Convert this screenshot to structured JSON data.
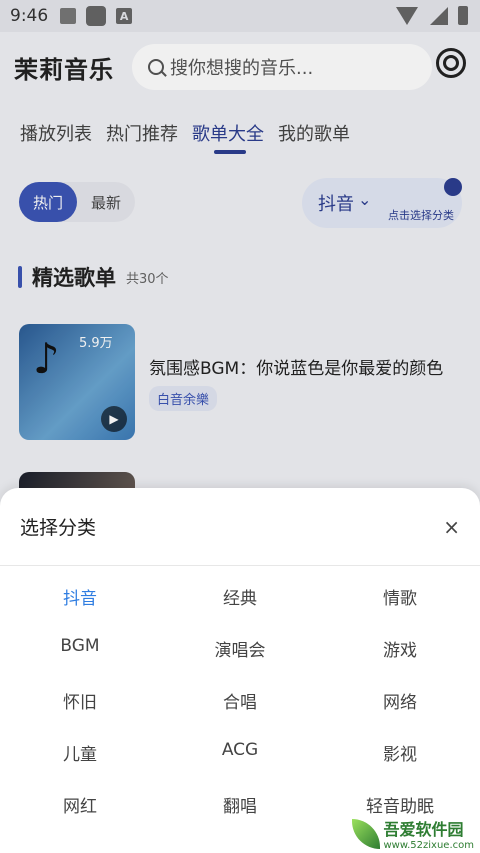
{
  "statusbar": {
    "time": "9:46",
    "badge": "A"
  },
  "header": {
    "title": "茉莉音乐",
    "search_placeholder": "搜你想搜的音乐..."
  },
  "tabs": [
    "播放列表",
    "热门推荐",
    "歌单大全",
    "我的歌单"
  ],
  "filters": [
    "热门",
    "最新"
  ],
  "category": {
    "label": "抖音",
    "hint": "点击选择分类"
  },
  "section": {
    "title": "精选歌单",
    "count": "共30个"
  },
  "playlists": [
    {
      "plays": "5.9万",
      "title": "氛围感BGM：你说蓝色是你最爱的颜色",
      "tag": "白音余樂"
    }
  ],
  "sheet": {
    "title": "选择分类",
    "close": "×",
    "items": [
      "抖音",
      "经典",
      "情歌",
      "BGM",
      "演唱会",
      "游戏",
      "怀旧",
      "合唱",
      "网络",
      "儿童",
      "ACG",
      "影视",
      "网红",
      "翻唱",
      "轻音助眠"
    ]
  },
  "watermark": {
    "main": "吾爱软件园",
    "url": "www.52zixue.com"
  },
  "colors": {
    "accent": "#3c56b6",
    "selected": "#2f7de1"
  }
}
